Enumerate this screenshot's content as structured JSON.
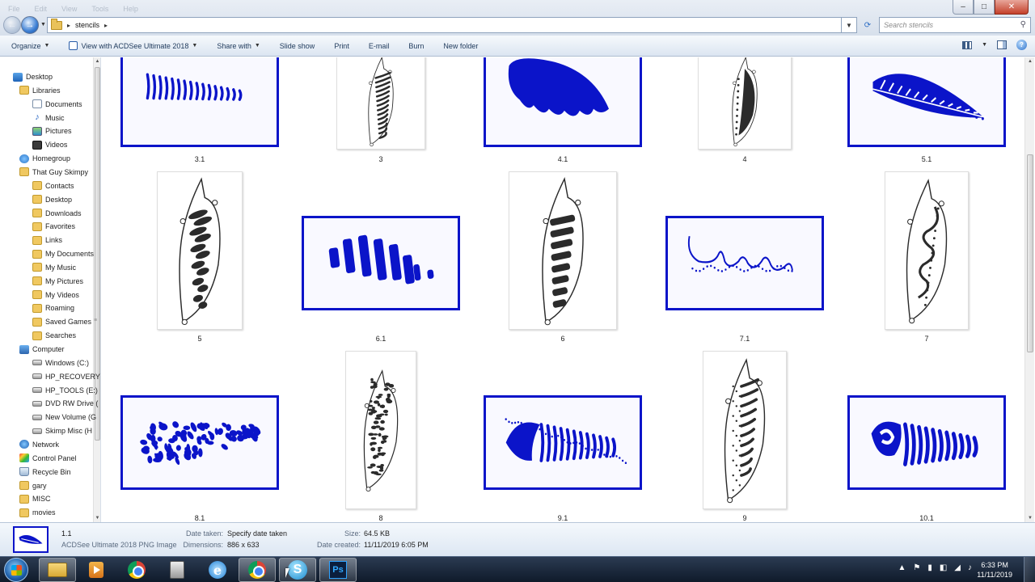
{
  "window": {
    "menu_ghost": [
      "File",
      "Edit",
      "View",
      "Tools",
      "Help"
    ],
    "min": "–",
    "max": "□",
    "close": "✕"
  },
  "address": {
    "back": "←",
    "forward": "→",
    "crumbs": [
      "stencils"
    ],
    "search_placeholder": "Search stencils",
    "search_icon": "magnifier-icon"
  },
  "commands": {
    "organize": "Organize",
    "view_with": "View with ACDSee Ultimate 2018",
    "share_with": "Share with",
    "slide_show": "Slide show",
    "print": "Print",
    "email": "E-mail",
    "burn": "Burn",
    "new_folder": "New folder"
  },
  "nav": {
    "items": [
      {
        "label": "Desktop",
        "icon": "desktop-icon"
      },
      {
        "label": "Libraries",
        "icon": "folder-icon"
      },
      {
        "label": "Documents",
        "icon": "documents-icon"
      },
      {
        "label": "Music",
        "icon": "music-icon"
      },
      {
        "label": "Pictures",
        "icon": "pictures-icon"
      },
      {
        "label": "Videos",
        "icon": "videos-icon"
      },
      {
        "label": "Homegroup",
        "icon": "homegroup-icon"
      },
      {
        "label": "That Guy Skimpy",
        "icon": "user-folder-icon"
      },
      {
        "label": "Contacts",
        "icon": "folder-icon"
      },
      {
        "label": "Desktop",
        "icon": "folder-icon"
      },
      {
        "label": "Downloads",
        "icon": "folder-icon"
      },
      {
        "label": "Favorites",
        "icon": "folder-icon"
      },
      {
        "label": "Links",
        "icon": "folder-icon"
      },
      {
        "label": "My Documents",
        "icon": "folder-icon"
      },
      {
        "label": "My Music",
        "icon": "folder-icon"
      },
      {
        "label": "My Pictures",
        "icon": "folder-icon"
      },
      {
        "label": "My Videos",
        "icon": "folder-icon"
      },
      {
        "label": "Roaming",
        "icon": "folder-icon"
      },
      {
        "label": "Saved Games",
        "icon": "folder-icon"
      },
      {
        "label": "Searches",
        "icon": "folder-icon"
      },
      {
        "label": "Computer",
        "icon": "computer-icon"
      },
      {
        "label": "Windows (C:)",
        "icon": "drive-icon"
      },
      {
        "label": "HP_RECOVERY",
        "icon": "drive-icon"
      },
      {
        "label": "HP_TOOLS (E:)",
        "icon": "drive-icon"
      },
      {
        "label": "DVD RW Drive (",
        "icon": "drive-icon"
      },
      {
        "label": "New Volume (G",
        "icon": "drive-icon"
      },
      {
        "label": "Skimp Misc  (H",
        "icon": "drive-icon"
      },
      {
        "label": "Network",
        "icon": "network-icon"
      },
      {
        "label": "Control Panel",
        "icon": "control-panel-icon"
      },
      {
        "label": "Recycle Bin",
        "icon": "recycle-bin-icon"
      },
      {
        "label": "gary",
        "icon": "folder-icon"
      },
      {
        "label": "MISC",
        "icon": "folder-icon"
      },
      {
        "label": "movies",
        "icon": "folder-icon"
      }
    ]
  },
  "files": [
    {
      "name": "3.1",
      "kind": "blue",
      "art": "stripes-thin"
    },
    {
      "name": "3",
      "kind": "leaf",
      "art": "leaf-bands"
    },
    {
      "name": "4.1",
      "kind": "blue",
      "art": "solid-scallop"
    },
    {
      "name": "4",
      "kind": "leaf",
      "art": "leaf-dots-solid"
    },
    {
      "name": "5.1",
      "kind": "blue",
      "art": "feather-barbs"
    },
    {
      "name": "5",
      "kind": "leaf",
      "art": "leaf-blotch"
    },
    {
      "name": "6.1",
      "kind": "blue",
      "art": "thick-bars"
    },
    {
      "name": "6",
      "kind": "leaf",
      "art": "leaf-bars"
    },
    {
      "name": "7.1",
      "kind": "blue",
      "art": "swirl-line"
    },
    {
      "name": "7",
      "kind": "leaf",
      "art": "leaf-swirl"
    },
    {
      "name": "8.1",
      "kind": "blue",
      "art": "speckle"
    },
    {
      "name": "8",
      "kind": "leaf",
      "art": "leaf-speckle"
    },
    {
      "name": "9.1",
      "kind": "blue",
      "art": "stripes-dotted"
    },
    {
      "name": "9",
      "kind": "leaf",
      "art": "leaf-stripes-dotted"
    },
    {
      "name": "10.1",
      "kind": "blue",
      "art": "curl-stripes"
    }
  ],
  "details": {
    "name": "1.1",
    "type": "ACDSee Ultimate 2018 PNG Image",
    "date_taken_label": "Date taken:",
    "date_taken": "Specify date taken",
    "dimensions_label": "Dimensions:",
    "dimensions": "886 x 633",
    "size_label": "Size:",
    "size": "64.5 KB",
    "date_created_label": "Date created:",
    "date_created": "11/11/2019 6:05 PM"
  },
  "taskbar": {
    "apps": [
      "windows-explorer-icon",
      "media-player-icon",
      "chrome-icon",
      "camera-icon",
      "internet-explorer-icon",
      "chrome-icon",
      "skype-icon",
      "photoshop-icon"
    ],
    "ie_letter": "e",
    "skype_letter": "S",
    "ps_letter": "Ps",
    "time": "6:33 PM",
    "date": "11/11/2019"
  },
  "colors": {
    "stencil_blue": "#0b14c9",
    "leaf_ink": "#2b2b2b"
  }
}
